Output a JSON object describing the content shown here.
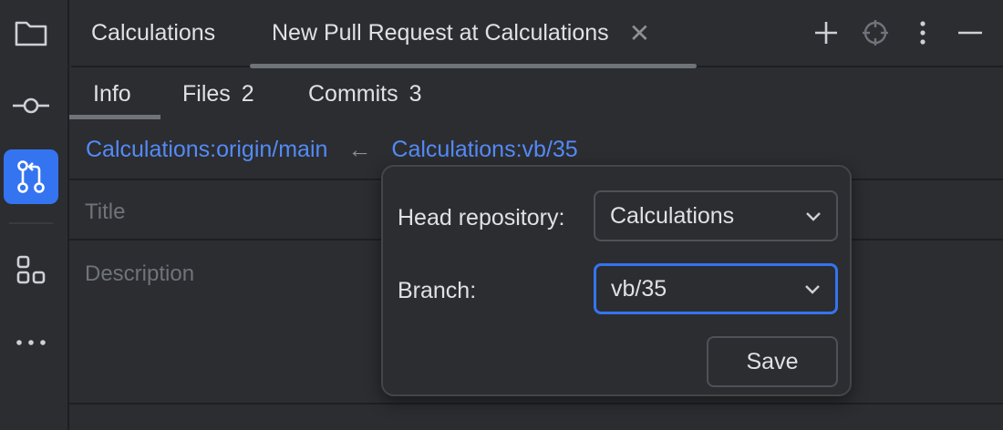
{
  "tool_strip": {
    "items": [
      {
        "icon": "folder-icon"
      },
      {
        "icon": "commit-icon"
      },
      {
        "icon": "pull-request-icon",
        "active": true
      },
      {
        "icon": "structure-icon"
      },
      {
        "icon": "more-icon"
      }
    ]
  },
  "tabs": [
    {
      "label": "Calculations"
    },
    {
      "label": "New Pull Request at Calculations"
    }
  ],
  "toolbar": {
    "icons": [
      "add-icon",
      "target-icon",
      "vertical-dots-icon",
      "minimize-icon"
    ]
  },
  "subtabs": {
    "info": {
      "label": "Info"
    },
    "files": {
      "label": "Files",
      "count": "2"
    },
    "commits": {
      "label": "Commits",
      "count": "3"
    }
  },
  "branches": {
    "base": "Calculations:origin/main",
    "arrow": "←",
    "head": "Calculations:vb/35"
  },
  "form": {
    "title_placeholder": "Title",
    "description_placeholder": "Description"
  },
  "popup": {
    "head_repo_label": "Head repository:",
    "head_repo_value": "Calculations",
    "branch_label": "Branch:",
    "branch_value": "vb/35",
    "save_label": "Save"
  },
  "colors": {
    "accent": "#3574f0",
    "link": "#548af7",
    "background": "#2b2d30"
  }
}
